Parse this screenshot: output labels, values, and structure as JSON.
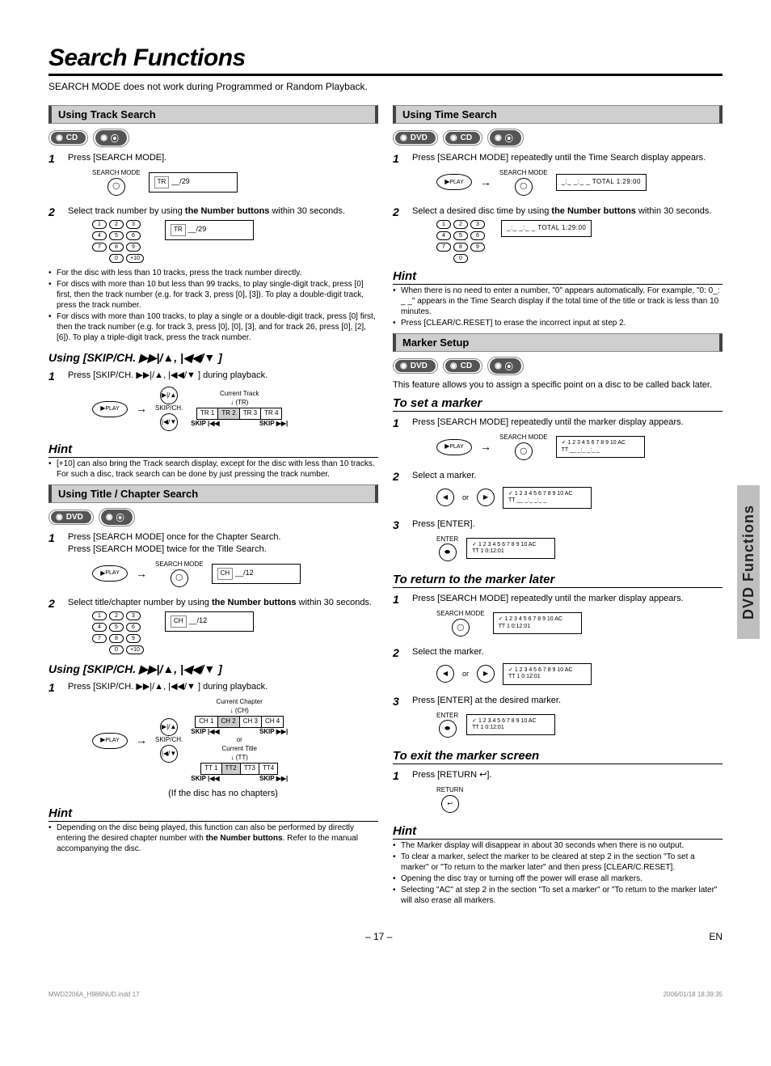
{
  "title": "Search Functions",
  "note": "SEARCH MODE does not work during Programmed or Random Playback.",
  "side_tab": "DVD Functions",
  "footer_page": "– 17 –",
  "footer_lang": "EN",
  "foot_left": "MWD2206A_H986NUD.indd   17",
  "foot_right": "2006/01/18   18:39:35",
  "left": {
    "sec1_header": "Using Track Search",
    "badge_cd": "CD",
    "s1_text": "Press [SEARCH MODE].",
    "s1_lbl": "SEARCH MODE",
    "play_lbl": "PLAY",
    "osd_tr29": "__/29",
    "s2_text_a": "Select track number by using ",
    "s2_bold": "the Number buttons",
    "s2_text_b": " within 30 seconds.",
    "bul1": "For the disc with less than 10 tracks, press the track number directly.",
    "bul2": "For discs with more than 10 but less than 99 tracks, to play single-digit track, press [0] first, then the track number (e.g. for track 3, press [0], [3]). To play a double-digit track, press the track number.",
    "bul3": "For discs with more than 100 tracks, to play a single or a double-digit track, press [0] first, then the track number (e.g. for track 3, press [0], [0], [3], and for track 26, press [0], [2], [6]). To play a triple-digit track, press the track number.",
    "using1": "Using [SKIP/CH. ▶▶|/▲, |◀◀/▼ ]",
    "u1_step": "Press [SKIP/CH. ▶▶|/▲, |◀◀/▼ ] during playback.",
    "skipch": "SKIP/CH.",
    "cur_track": "Current Track",
    "abbr_tr": "(TR)",
    "tr1": "TR 1",
    "tr2": "TR 2",
    "tr3": "TR 3",
    "tr4": "TR 4",
    "skip_prev": "SKIP |◀◀",
    "skip_next": "SKIP ▶▶|",
    "hint": "Hint",
    "hint1_b": "[+10] can also bring the Track search display, except for the disc with less than 10 tracks. For such a disc, track search can be done by just pressing the track number.",
    "sec2_header": "Using Title / Chapter Search",
    "badge_dvd": "DVD",
    "s21a": "Press [SEARCH MODE] once for the Chapter Search.",
    "s21b": "Press [SEARCH MODE] twice for the Title Search.",
    "osd_12": "__/12",
    "s22a": "Select title/chapter number by using ",
    "s22bold": "the Number buttons",
    "s22b": " within 30 seconds.",
    "using2": "Using [SKIP/CH. ▶▶|/▲, |◀◀/▼ ]",
    "u2_step": "Press [SKIP/CH. ▶▶|/▲, |◀◀/▼ ] during playback.",
    "cur_ch": "Current Chapter",
    "abbr_ch": "(CH)",
    "ch1": "CH 1",
    "ch2": "CH 2",
    "ch3": "CH 3",
    "ch4": "CH 4",
    "or": "or",
    "cur_tt": "Current Title",
    "abbr_tt": "(TT)",
    "tt1": "TT 1",
    "tt2": "TT2",
    "tt3": "TT3",
    "tt4": "TT4",
    "nochap": "(If the disc has no chapters)",
    "hint2a": "Depending on the disc being played, this function can also be performed by directly entering the desired chapter number with ",
    "hint2bold": "the Number buttons",
    "hint2b": ". Refer to the manual accompanying the disc."
  },
  "right": {
    "sec1_header": "Using Time Search",
    "badge_dvd": "DVD",
    "badge_cd": "CD",
    "s1a": "Press [SEARCH MODE] repeatedly until the Time Search display appears.",
    "time_osd": "_:_ _:_ _  TOTAL  1:29:00",
    "s2a": "Select a desired disc time by using ",
    "s2bold": "the Number buttons",
    "s2b": " within 30 seconds.",
    "hint": "Hint",
    "hintb1": "When there is no need to enter a number, \"0\" appears automatically. For example, \"0: 0_: _ _\" appears in the Time Search display if the total time of the title or track is less than 10 minutes.",
    "hintb2": "Press [CLEAR/C.RESET] to erase the incorrect input at step 2.",
    "sec2_header": "Marker Setup",
    "mdesc": "This feature allows you to assign a specific point on a disc to be called back later.",
    "sub_set": "To set a marker",
    "m1": "Press [SEARCH MODE] repeatedly until the marker display appears.",
    "m2": "Select a marker.",
    "m3": "Press [ENTER].",
    "enter": "ENTER",
    "osd_m_nums": "1 2 3 4 5 6 7 8 9 10 AC",
    "osd_m_under": "__ _:_ _:_ _",
    "osd_m_time": "1  0:12:01",
    "tt_prefix": "TT",
    "sub_return": "To return to the marker later",
    "r1": "Press [SEARCH MODE] repeatedly until the marker display appears.",
    "r2": "Select the marker.",
    "r3": "Press [ENTER] at the desired marker.",
    "sub_exit": "To exit the marker screen",
    "e1": "Press [RETURN ↩].",
    "return": "RETURN",
    "fb1": "The Marker display will disappear in about 30 seconds when there is no output.",
    "fb2": "To clear a marker, select the marker to be cleared at step 2 in the section \"To set a marker\" or \"To return to the marker later\" and then press [CLEAR/C.RESET].",
    "fb3": "Opening the disc tray or turning off the power will erase all markers.",
    "fb4": "Selecting \"AC\" at step 2 in the section \"To set a marker\" or \"To return to the marker later\" will also erase all markers.",
    "search_mode": "SEARCH MODE",
    "play_lbl": "PLAY"
  }
}
